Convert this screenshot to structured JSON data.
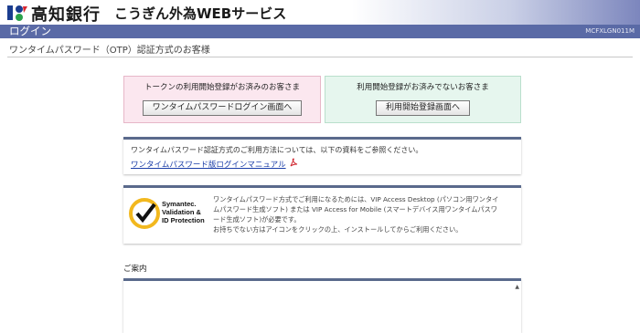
{
  "header": {
    "bank_name": "高知銀行",
    "service_name": "こうぎん外為WEBサービス"
  },
  "titlebar": {
    "title": "ログイン",
    "screen_code": "MCFXLGN011M"
  },
  "subheading": "ワンタイムパスワード（OTP）認証方式のお客様",
  "token_registered": {
    "title": "トークンの利用開始登録がお済みのお客さま",
    "button_label": "ワンタイムパスワードログイン画面へ"
  },
  "not_registered": {
    "title": "利用開始登録がお済みでないお客さま",
    "button_label": "利用開始登録画面へ"
  },
  "manual_info": {
    "text": "ワンタイムパスワード認証方式のご利用方法については、以下の資料をご参照ください。",
    "link_label": "ワンタイムパスワード版ログインマニュアル"
  },
  "symantec": {
    "logo_text": [
      "Symantec.",
      "Validation &",
      "ID Protection"
    ],
    "description": [
      "ワンタイムパスワード方式でご利用になるためには、VIP Access Desktop (パソコン用ワンタイ",
      "ムパスワード生成ソフト) または VIP Access for Mobile (スマートデバイス用ワンタイムパスワ",
      "ード生成ソフト)が必要です。",
      "お持ちでない方はアイコンをクリックの上、インストールしてからご利用ください。"
    ]
  },
  "guide": {
    "label": "ご案内",
    "scroll_icon": "▲"
  },
  "colors": {
    "titlebar": "#5a6aa6",
    "pink_box": "#fbe7ef",
    "green_box": "#e6f6ee",
    "link": "#1a3da8",
    "symantec_yellow": "#f2b81e"
  }
}
